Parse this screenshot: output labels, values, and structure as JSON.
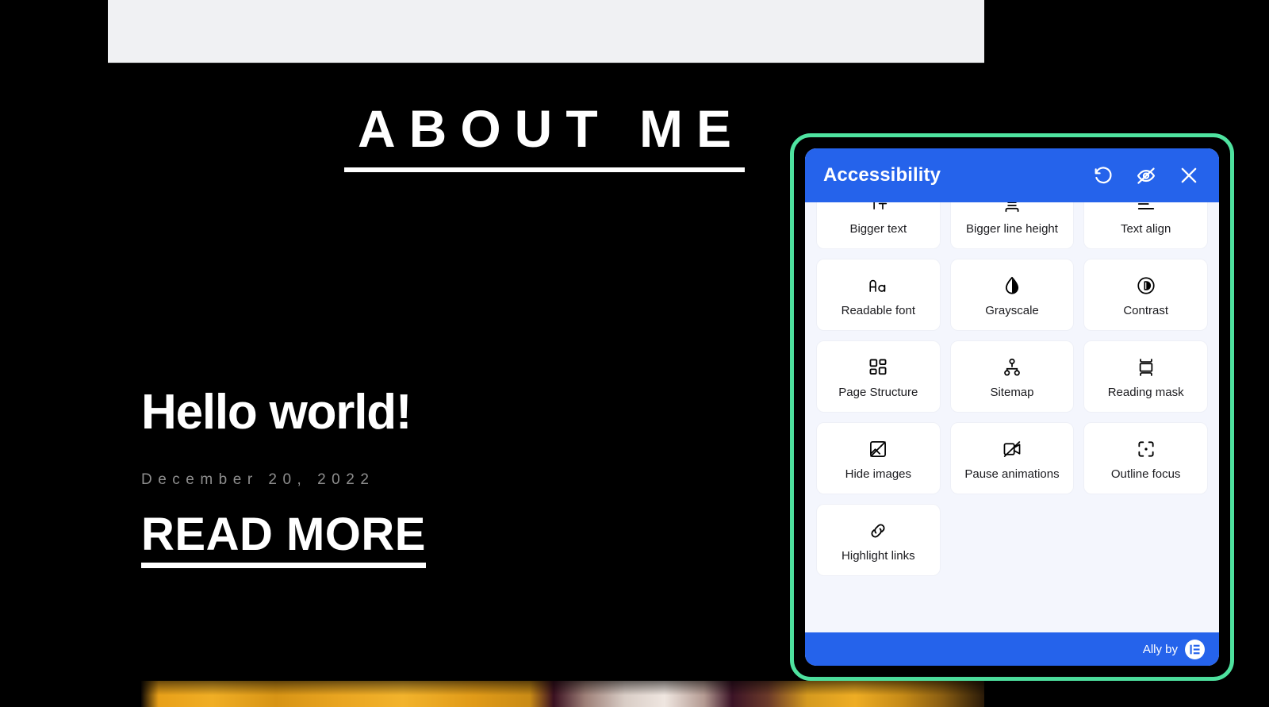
{
  "site": {
    "section_heading": "ABOUT ME",
    "post_title": "Hello world!",
    "post_date": "December 20, 2022",
    "read_more_label": "READ MORE"
  },
  "widget": {
    "title": "Accessibility",
    "header_actions": [
      {
        "name": "reset-icon",
        "label": "Reset"
      },
      {
        "name": "hide-interface-icon",
        "label": "Hide interface"
      },
      {
        "name": "close-icon",
        "label": "Close"
      }
    ],
    "tiles": [
      {
        "icon": "bigger-text-icon",
        "label": "Bigger text"
      },
      {
        "icon": "bigger-line-height-icon",
        "label": "Bigger line height"
      },
      {
        "icon": "text-align-icon",
        "label": "Text align"
      },
      {
        "icon": "readable-font-icon",
        "label": "Readable font"
      },
      {
        "icon": "grayscale-icon",
        "label": "Grayscale"
      },
      {
        "icon": "contrast-icon",
        "label": "Contrast"
      },
      {
        "icon": "page-structure-icon",
        "label": "Page Structure"
      },
      {
        "icon": "sitemap-icon",
        "label": "Sitemap"
      },
      {
        "icon": "reading-mask-icon",
        "label": "Reading mask"
      },
      {
        "icon": "hide-images-icon",
        "label": "Hide images"
      },
      {
        "icon": "pause-animations-icon",
        "label": "Pause animations"
      },
      {
        "icon": "outline-focus-icon",
        "label": "Outline focus"
      },
      {
        "icon": "highlight-links-icon",
        "label": "Highlight links"
      }
    ],
    "footer": {
      "credit": "Ally by",
      "logo": "elementor-logo"
    },
    "colors": {
      "header_blue": "#2563eb",
      "footer_blue": "#2563eb",
      "panel_background": "#f4f6fd",
      "tile_background": "#ffffff",
      "focus_ring_green": "#4fe3a0",
      "page_background": "#000000"
    }
  }
}
